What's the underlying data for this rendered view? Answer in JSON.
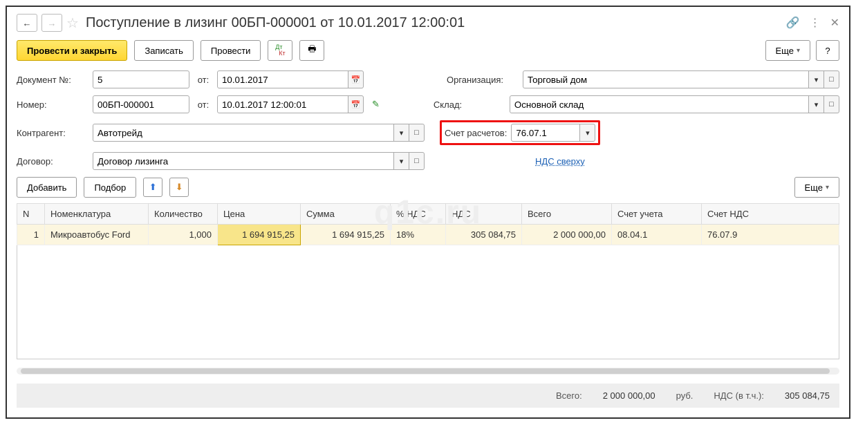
{
  "title": "Поступление в лизинг 00БП-000001 от 10.01.2017 12:00:01",
  "toolbar": {
    "primary": "Провести и закрыть",
    "save": "Записать",
    "post": "Провести",
    "more": "Еще",
    "help": "?"
  },
  "form": {
    "doc_no_label": "Документ №:",
    "doc_no": "5",
    "ot1": "от:",
    "date1": "10.01.2017",
    "org_label": "Организация:",
    "org": "Торговый дом",
    "num_label": "Номер:",
    "num": "00БП-000001",
    "ot2": "от:",
    "date2": "10.01.2017 12:00:01",
    "sklad_label": "Склад:",
    "sklad": "Основной склад",
    "kontr_label": "Контрагент:",
    "kontr": "Автотрейд",
    "schet_label": "Счет расчетов:",
    "schet": "76.07.1",
    "dog_label": "Договор:",
    "dog": "Договор лизинга",
    "nds_link": "НДС сверху"
  },
  "grid_toolbar": {
    "add": "Добавить",
    "pick": "Подбор",
    "more": "Еще"
  },
  "grid": {
    "headers": {
      "n": "N",
      "nomen": "Номенклатура",
      "qty": "Количество",
      "price": "Цена",
      "sum": "Сумма",
      "nds_pct": "% НДС",
      "nds": "НДС",
      "total": "Всего",
      "acct": "Счет учета",
      "nds_acct": "Счет НДС"
    },
    "row": {
      "n": "1",
      "nomen": "Микроавтобус Ford",
      "qty": "1,000",
      "price": "1 694 915,25",
      "sum": "1 694 915,25",
      "nds_pct": "18%",
      "nds": "305 084,75",
      "total": "2 000 000,00",
      "acct": "08.04.1",
      "nds_acct": "76.07.9"
    }
  },
  "footer": {
    "total_label": "Всего:",
    "total": "2 000 000,00",
    "rub": "руб.",
    "nds_label": "НДС (в т.ч.):",
    "nds": "305 084,75"
  },
  "watermark": "q1c.ru"
}
